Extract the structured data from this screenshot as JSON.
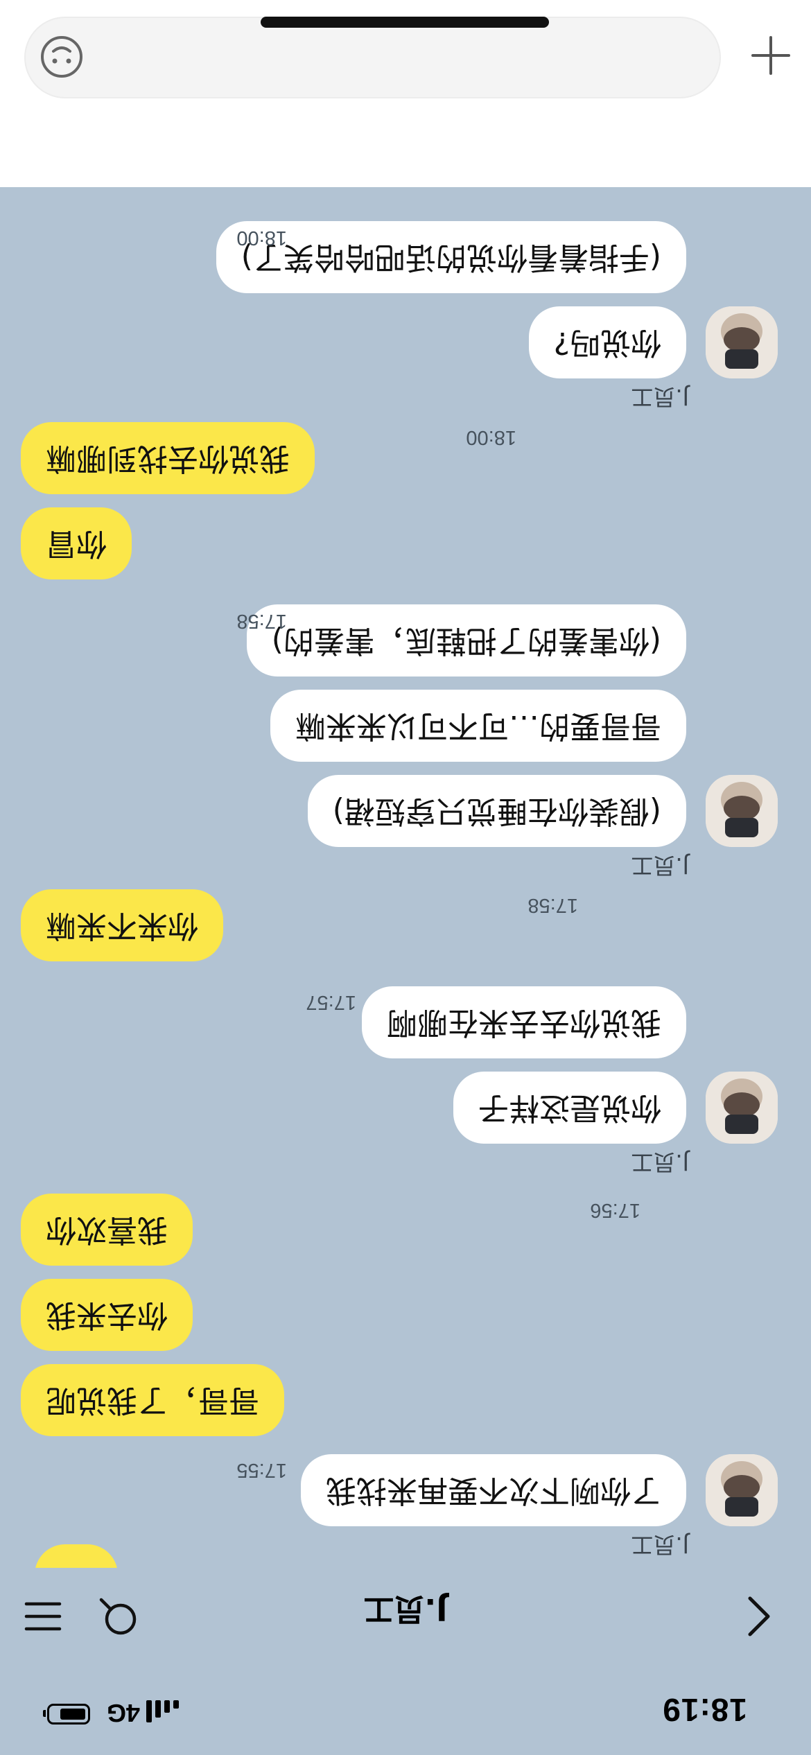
{
  "status_bar": {
    "time": "18:19",
    "network": "4G"
  },
  "nav": {
    "title": "J.员工"
  },
  "messages": [
    {
      "sender": "J.员工",
      "text": "了你咧下次不要再来找我",
      "time": "17:55"
    },
    {
      "text": "哥哥，了我说呢"
    },
    {
      "text": "你去来我"
    },
    {
      "text": "我喜欢你",
      "time": "17:56"
    },
    {
      "sender": "J.员工",
      "text": "你说是这样子"
    },
    {
      "text": "我说你去去来在哪啊",
      "time": "17:57"
    },
    {
      "text": "你来不来嘛",
      "time": "17:58"
    },
    {
      "sender": "J.员工",
      "text": "(假装你在睡觉只穿短裙)"
    },
    {
      "text": "哥哥要的…可不可以来来嘛"
    },
    {
      "text": "(你害羞的了把鞋底，害羞的)",
      "time": "17:58"
    },
    {
      "text": "你冒"
    },
    {
      "text": "我说你去找到哪嘛",
      "time": "18:00"
    },
    {
      "sender": "J.员工",
      "text": "你说吗?"
    },
    {
      "text": "(手指着看你说的话吧哈哈笑了)",
      "time": "18:00"
    }
  ],
  "composer": {
    "placeholder": ""
  }
}
